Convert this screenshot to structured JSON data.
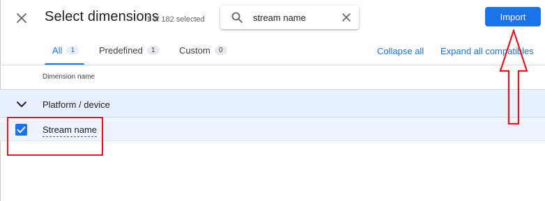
{
  "header": {
    "title": "Select dimensions",
    "selected_count": "1 of 182 selected",
    "close_icon": "close-icon"
  },
  "search": {
    "value": "stream name",
    "search_icon": "search-icon",
    "clear_icon": "clear-icon"
  },
  "actions": {
    "import_label": "Import"
  },
  "tabs": [
    {
      "label": "All",
      "count": "1",
      "active": true
    },
    {
      "label": "Predefined",
      "count": "1",
      "active": false
    },
    {
      "label": "Custom",
      "count": "0",
      "active": false
    }
  ],
  "links": {
    "collapse_all": "Collapse all",
    "expand_all": "Expand all compatibles"
  },
  "table": {
    "column_header": "Dimension name",
    "groups": [
      {
        "label": "Platform / device",
        "expanded": true,
        "items": [
          {
            "label": "Stream name",
            "checked": true
          }
        ]
      }
    ]
  },
  "colors": {
    "accent": "#1a73e8",
    "row_highlight": "#e8f0fe",
    "annotation_red": "#e8141c"
  }
}
